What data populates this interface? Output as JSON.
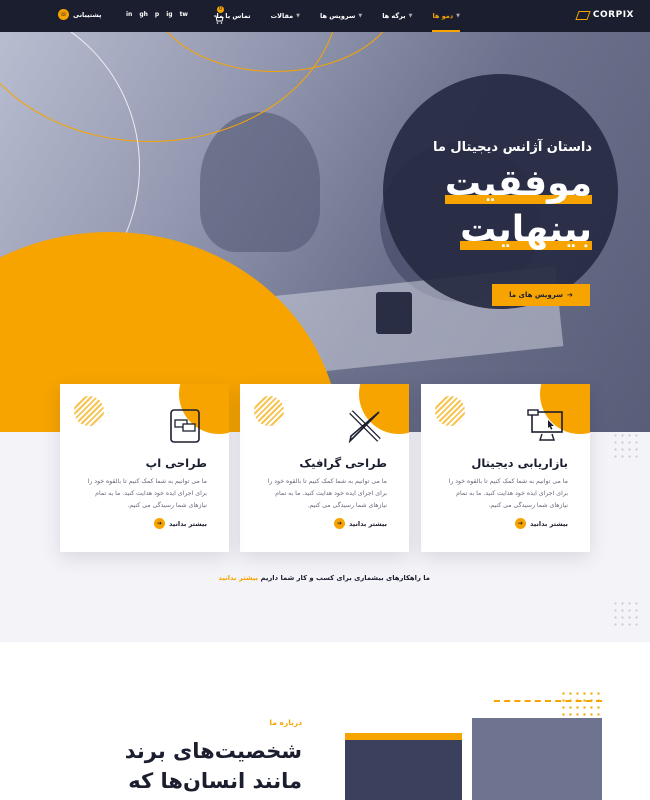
{
  "header": {
    "logo_text": "CORPIX",
    "nav": [
      {
        "label": "دمو ها",
        "active": true
      },
      {
        "label": "برگه ها",
        "active": false
      },
      {
        "label": "سرویس ها",
        "active": false
      },
      {
        "label": "مقالات",
        "active": false
      },
      {
        "label": "تماس با ما",
        "active": false
      }
    ],
    "cart_count": "0",
    "social": [
      "in",
      "gh",
      "p",
      "ig",
      "tw"
    ],
    "support_label": "پشتیبانی"
  },
  "hero": {
    "subtitle": "داستان آژانس دیجیتال ما",
    "title_line1": "موفقیت",
    "title_line2": "بینهایت",
    "cta_label": "سرویس های ما"
  },
  "services": [
    {
      "title": "بازاریابی دیجیتال",
      "description": "ما می توانیم به شما کمک کنیم تا بالقوه خود را برای اجرای ایده خود هدایت کنید. ما به تمام نیازهای شما رسیدگی می کنیم.",
      "more_label": "بیشتر بدانید",
      "icon": "monitor-pointer-icon"
    },
    {
      "title": "طراحی گرافیک",
      "description": "ما می توانیم به شما کمک کنیم تا بالقوه خود را برای اجرای ایده خود هدایت کنید. ما به تمام نیازهای شما رسیدگی می کنیم.",
      "more_label": "بیشتر بدانید",
      "icon": "pencil-ruler-icon"
    },
    {
      "title": "طراحی اپ",
      "description": "ما می توانیم به شما کمک کنیم تا بالقوه خود را برای اجرای ایده خود هدایت کنید. ما به تمام نیازهای شما رسیدگی می کنیم.",
      "more_label": "بیشتر بدانید",
      "icon": "tablet-chat-icon"
    }
  ],
  "cta_line": {
    "text": "ما راهکارهای بیشماری برای کسب و کار شما داریم",
    "link": "بیشتر بدانید"
  },
  "about": {
    "label": "درباره ما",
    "title_line1": "شخصیت‌های برند",
    "title_line2": "مانند انسان‌ها که"
  },
  "colors": {
    "accent": "#f7a400",
    "dark": "#1b1e2f"
  }
}
